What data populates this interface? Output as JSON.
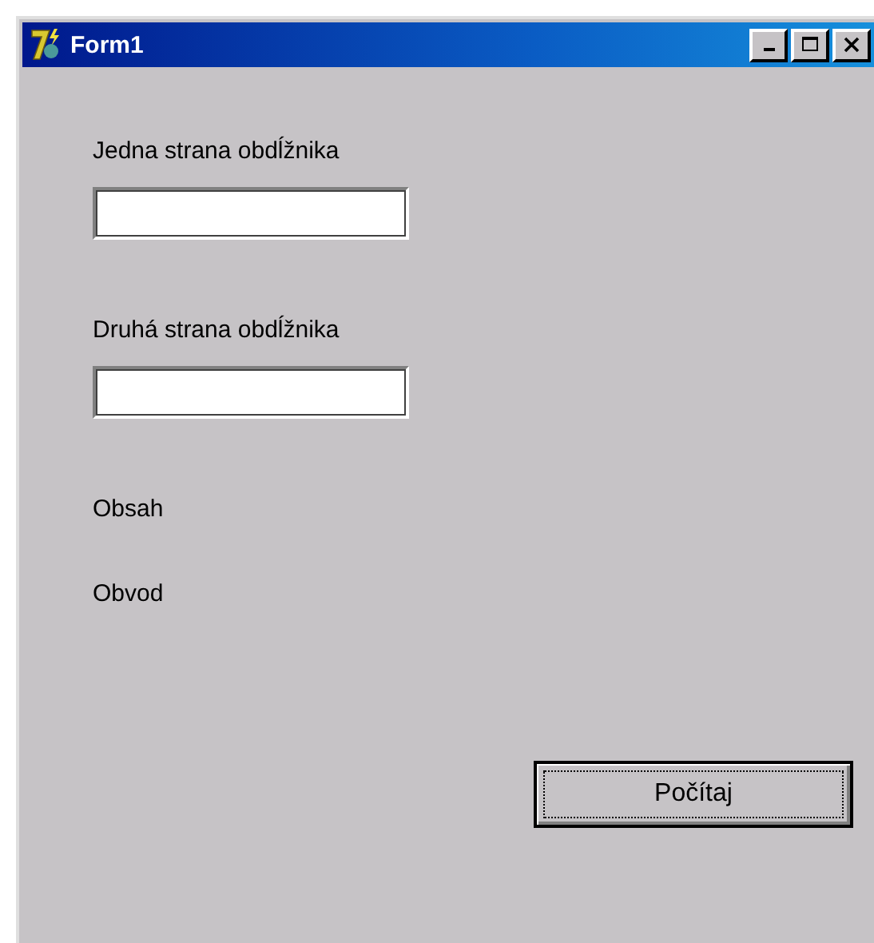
{
  "window": {
    "title": "Form1"
  },
  "fields": [
    {
      "label": "Jedna strana obdĺžnika"
    },
    {
      "label": "Druhá strana obdĺžnika"
    }
  ],
  "results": [
    "Obsah",
    "Obvod"
  ],
  "button": {
    "label": "Počítaj",
    "focused": true
  }
}
